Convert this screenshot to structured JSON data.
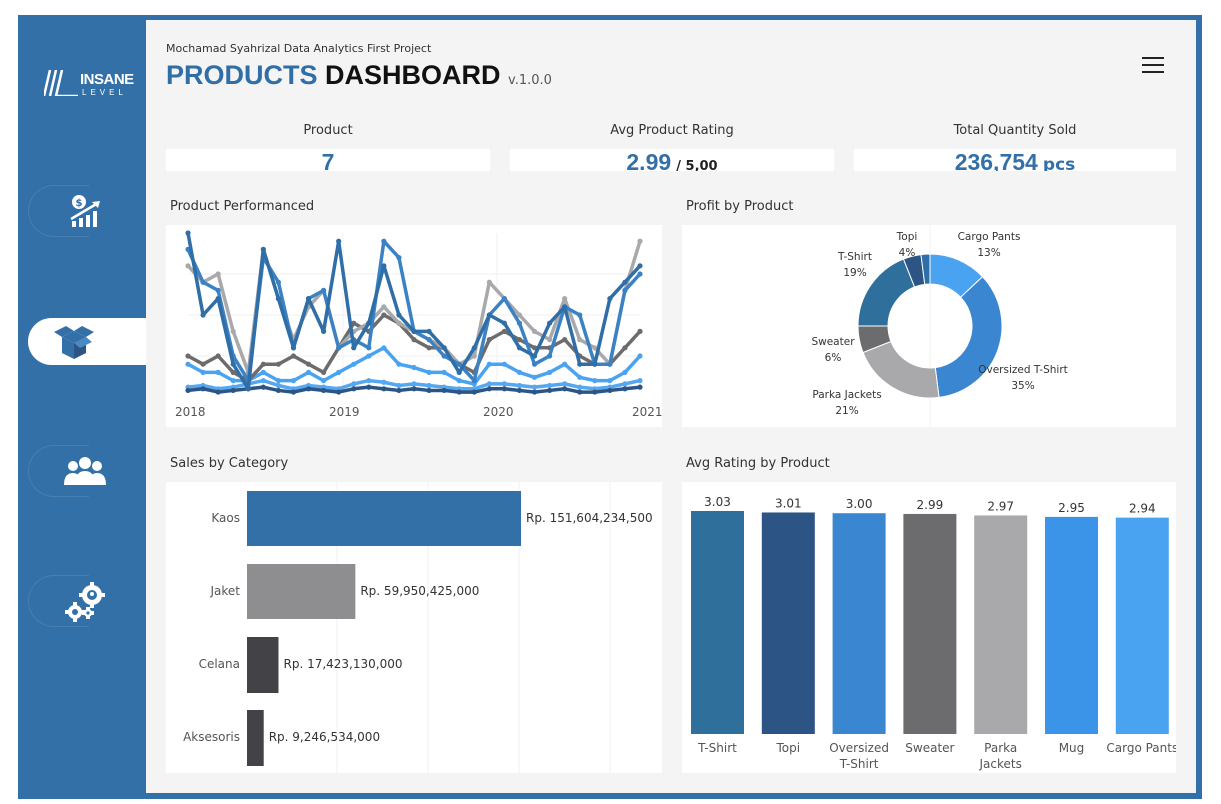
{
  "brand": {
    "logo_line1": "INSANE",
    "logo_line2": "LEVEL"
  },
  "sidebar": {
    "items": [
      {
        "icon": "money-growth-icon",
        "active": false
      },
      {
        "icon": "open-box-icon",
        "active": true
      },
      {
        "icon": "users-group-icon",
        "active": false
      },
      {
        "icon": "settings-gears-icon",
        "active": false
      }
    ]
  },
  "header": {
    "subtitle": "Mochamad Syahrizal Data Analytics First Project",
    "title_part1": "PRODUCTS",
    "title_part2": "DASHBOARD",
    "version": "v.1.0.0"
  },
  "kpis": {
    "product": {
      "label": "Product",
      "value": "7"
    },
    "rating": {
      "label": "Avg Product Rating",
      "value": "2.99",
      "suffix": "/ 5,00"
    },
    "quantity": {
      "label": "Total Quantity Sold",
      "value": "236,754",
      "unit": "pcs"
    }
  },
  "colors": {
    "primary": "#3470a8",
    "series": [
      "#2f6ea6",
      "#3b82c4",
      "#a9a9ab",
      "#6c6c6e",
      "#4aa3f0",
      "#2c5585",
      "#55a8ef"
    ]
  },
  "charts": {
    "performance_title": "Product Performanced",
    "profit_title": "Profit by Product",
    "sales_title": "Sales by Category",
    "rating_title": "Avg Rating by Product"
  },
  "chart_data": [
    {
      "type": "line",
      "title": "Product Performanced",
      "x_ticks": [
        "2018",
        "2019",
        "2020",
        "2021"
      ],
      "series": [
        {
          "color": "#2f6ea6",
          "values": [
            1.0,
            0.5,
            0.6,
            0.2,
            0.05,
            0.9,
            0.6,
            0.3,
            0.6,
            0.4,
            0.95,
            0.3,
            0.45,
            0.8,
            0.5,
            0.4,
            0.4,
            0.3,
            0.15,
            0.3,
            0.5,
            0.45,
            0.3,
            0.25,
            0.45,
            0.55,
            0.2,
            0.2,
            0.6,
            0.7,
            0.8
          ]
        },
        {
          "color": "#3b82c4",
          "values": [
            0.9,
            0.7,
            0.65,
            0.25,
            0.1,
            0.85,
            0.7,
            0.3,
            0.6,
            0.65,
            0.3,
            0.35,
            0.3,
            0.95,
            0.85,
            0.4,
            0.35,
            0.25,
            0.2,
            0.1,
            0.5,
            0.6,
            0.45,
            0.2,
            0.25,
            0.55,
            0.5,
            0.2,
            0.2,
            0.65,
            0.75
          ]
        },
        {
          "color": "#a9a9ab",
          "values": [
            0.8,
            0.7,
            0.75,
            0.4,
            0.15,
            0.9,
            0.6,
            0.35,
            0.55,
            0.65,
            0.3,
            0.4,
            0.45,
            0.55,
            0.45,
            0.4,
            0.35,
            0.3,
            0.2,
            0.25,
            0.7,
            0.6,
            0.5,
            0.4,
            0.35,
            0.6,
            0.35,
            0.3,
            0.2,
            0.65,
            0.95
          ]
        },
        {
          "color": "#6c6c6e",
          "values": [
            0.25,
            0.2,
            0.25,
            0.15,
            0.1,
            0.2,
            0.2,
            0.25,
            0.2,
            0.15,
            0.3,
            0.45,
            0.4,
            0.5,
            0.45,
            0.35,
            0.3,
            0.3,
            0.2,
            0.15,
            0.35,
            0.4,
            0.35,
            0.3,
            0.3,
            0.35,
            0.25,
            0.2,
            0.2,
            0.3,
            0.4
          ]
        },
        {
          "color": "#4aa3f0",
          "values": [
            0.2,
            0.15,
            0.15,
            0.1,
            0.1,
            0.15,
            0.1,
            0.1,
            0.15,
            0.1,
            0.15,
            0.2,
            0.25,
            0.3,
            0.2,
            0.18,
            0.15,
            0.15,
            0.1,
            0.08,
            0.2,
            0.2,
            0.15,
            0.12,
            0.15,
            0.2,
            0.12,
            0.1,
            0.1,
            0.15,
            0.25
          ]
        },
        {
          "color": "#2c5585",
          "values": [
            0.04,
            0.05,
            0.03,
            0.04,
            0.05,
            0.06,
            0.04,
            0.03,
            0.05,
            0.04,
            0.03,
            0.05,
            0.06,
            0.05,
            0.04,
            0.05,
            0.04,
            0.04,
            0.03,
            0.03,
            0.05,
            0.05,
            0.04,
            0.03,
            0.04,
            0.05,
            0.03,
            0.03,
            0.04,
            0.05,
            0.06
          ]
        },
        {
          "color": "#55a8ef",
          "values": [
            0.06,
            0.07,
            0.05,
            0.06,
            0.08,
            0.1,
            0.07,
            0.05,
            0.07,
            0.06,
            0.05,
            0.08,
            0.1,
            0.09,
            0.07,
            0.08,
            0.07,
            0.06,
            0.05,
            0.05,
            0.08,
            0.08,
            0.07,
            0.06,
            0.07,
            0.08,
            0.06,
            0.05,
            0.06,
            0.08,
            0.1
          ]
        }
      ]
    },
    {
      "type": "pie",
      "title": "Profit by Product",
      "slices": [
        {
          "label": "Cargo Pants",
          "pct": "13%",
          "value": 13,
          "color": "#4aa3f0"
        },
        {
          "label": "Oversized T-Shirt",
          "pct": "35%",
          "value": 35,
          "color": "#3b86d0"
        },
        {
          "label": "Parka Jackets",
          "pct": "21%",
          "value": 21,
          "color": "#a9a9ab"
        },
        {
          "label": "Sweater",
          "pct": "6%",
          "value": 6,
          "color": "#6c6c6e"
        },
        {
          "label": "T-Shirt",
          "pct": "19%",
          "value": 19,
          "color": "#2e6f9c"
        },
        {
          "label": "Topi",
          "pct": "4%",
          "value": 4,
          "color": "#2c5585"
        },
        {
          "label": "",
          "pct": "",
          "value": 2,
          "color": "#2f6ea6"
        }
      ]
    },
    {
      "type": "bar",
      "orientation": "horizontal",
      "title": "Sales by Category",
      "categories": [
        "Kaos",
        "Jaket",
        "Celana",
        "Aksesoris"
      ],
      "values": [
        151604234500,
        59950425000,
        17423130000,
        9246534000
      ],
      "labels": [
        "Rp. 151,604,234,500",
        "Rp. 59,950,425,000",
        "Rp. 17,423,130,000",
        "Rp. 9,246,534,000"
      ],
      "colors": [
        "#3470a8",
        "#8e8e90",
        "#434347",
        "#434347"
      ]
    },
    {
      "type": "bar",
      "title": "Avg Rating by Product",
      "categories": [
        "T-Shirt",
        "Topi",
        "Oversized T-Shirt",
        "Sweater",
        "Parka Jackets",
        "Mug",
        "Cargo Pants"
      ],
      "category_lines": [
        [
          "T-Shirt"
        ],
        [
          "Topi"
        ],
        [
          "Oversized",
          "T-Shirt"
        ],
        [
          "Sweater"
        ],
        [
          "Parka",
          "Jackets"
        ],
        [
          "Mug"
        ],
        [
          "Cargo Pants"
        ]
      ],
      "values": [
        3.03,
        3.01,
        3.0,
        2.99,
        2.97,
        2.95,
        2.94
      ],
      "labels": [
        "3.03",
        "3.01",
        "3.00",
        "2.99",
        "2.97",
        "2.95",
        "2.94"
      ],
      "colors": [
        "#2e6f9c",
        "#2c5585",
        "#3b86d0",
        "#6c6c6e",
        "#a9a9ab",
        "#3b94e8",
        "#4aa3f0"
      ]
    }
  ]
}
